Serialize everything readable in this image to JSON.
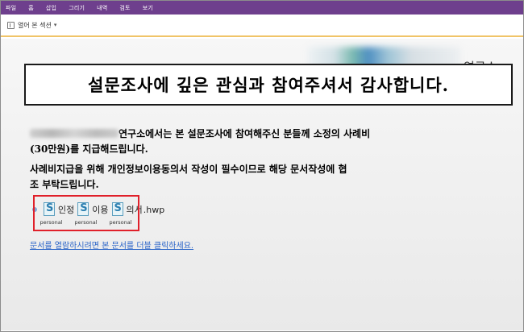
{
  "menu": {
    "items": [
      "파일",
      "홈",
      "삽입",
      "그리기",
      "내역",
      "검토",
      "보기"
    ]
  },
  "toolbar": {
    "section_label": "열어 본 섹션"
  },
  "header": {
    "logo_text": "연구소"
  },
  "banner": {
    "title": "설문조사에 깊은 관심과 참여주셔서 감사합니다."
  },
  "body": {
    "para1_line1": "연구소에서는 본 설문조사에 참여해주신 분들께 소정의 사례비",
    "para1_line2": "(30만원)를 지급해드립니다.",
    "para2_line1": "사례비지급을 위해 개인정보이용동의서 작성이 필수이므로 해당 문서작성에 협",
    "para2_line2": "조 부탁드립니다."
  },
  "attachment": {
    "fragments": [
      "인정",
      "이용",
      "의서",
      ".hwp"
    ],
    "captions": [
      "personal",
      "personal",
      "personal"
    ]
  },
  "link": {
    "text": "문서를 열람하시려면 본 문서를 더블 클릭하세요."
  },
  "colors": {
    "menubar": "#6e3f8d",
    "toolbar_underline": "#f0c468",
    "attachment_outline": "#e0202a",
    "link": "#2a64c8"
  }
}
